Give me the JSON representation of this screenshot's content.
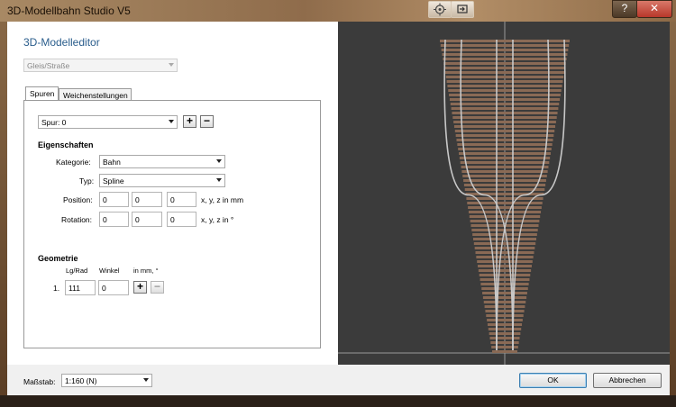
{
  "window": {
    "title": "3D-Modellbahn Studio V5",
    "buttons": {
      "help": "?",
      "close": "✕"
    }
  },
  "editor": {
    "title": "3D-Modelleditor",
    "object_type": "Gleis/Straße",
    "tabs": [
      {
        "label": "Spuren"
      },
      {
        "label": "Weichenstellungen"
      }
    ],
    "track_select": "Spur: 0",
    "add_symbol": "+",
    "remove_symbol": "−",
    "properties": {
      "heading": "Eigenschaften",
      "category_label": "Kategorie:",
      "category_value": "Bahn",
      "type_label": "Typ:",
      "type_value": "Spline",
      "position_label": "Position:",
      "position": [
        "0",
        "0",
        "0"
      ],
      "position_unit": "x, y, z in mm",
      "rotation_label": "Rotation:",
      "rotation": [
        "0",
        "0",
        "0"
      ],
      "rotation_unit": "x, y, z in °"
    },
    "geometry": {
      "heading": "Geometrie",
      "col_length": "Lg/Rad",
      "col_angle": "Winkel",
      "col_unit": "in mm, °",
      "rows": [
        {
          "index": "1.",
          "length": "111",
          "angle": "0"
        }
      ]
    }
  },
  "footer": {
    "scale_label": "Maßstab:",
    "scale_value": "1:160 (N)",
    "ok": "OK",
    "cancel": "Abbrechen"
  },
  "viewport": {
    "background": "#3b3b3b",
    "sleeper_color": "#8a6a55",
    "rail_color": "#c8c8c8"
  }
}
